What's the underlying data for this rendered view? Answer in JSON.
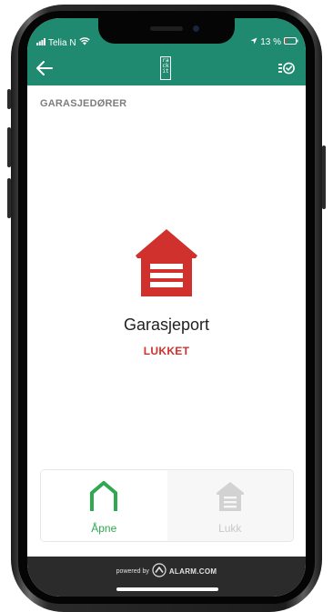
{
  "status_bar": {
    "carrier": "Telia N",
    "battery_percent": "13 %",
    "battery_level": 0.13,
    "background_color": "#1f8a70"
  },
  "app_bar": {
    "back_icon": "arrow-left-icon",
    "logo_text": "rack it",
    "scene_icon": "list-check-icon"
  },
  "section": {
    "title": "GARASJEDØRER"
  },
  "device": {
    "name": "Garasjeport",
    "status": "LUKKET",
    "status_color": "#d0312d",
    "icon": "garage-icon"
  },
  "controls": {
    "open_label": "Åpne",
    "close_label": "Lukk",
    "open_color": "#2fa84f",
    "close_color": "#c8c8c8"
  },
  "footer": {
    "powered_by": "powered by",
    "brand": "ALARM.COM"
  }
}
